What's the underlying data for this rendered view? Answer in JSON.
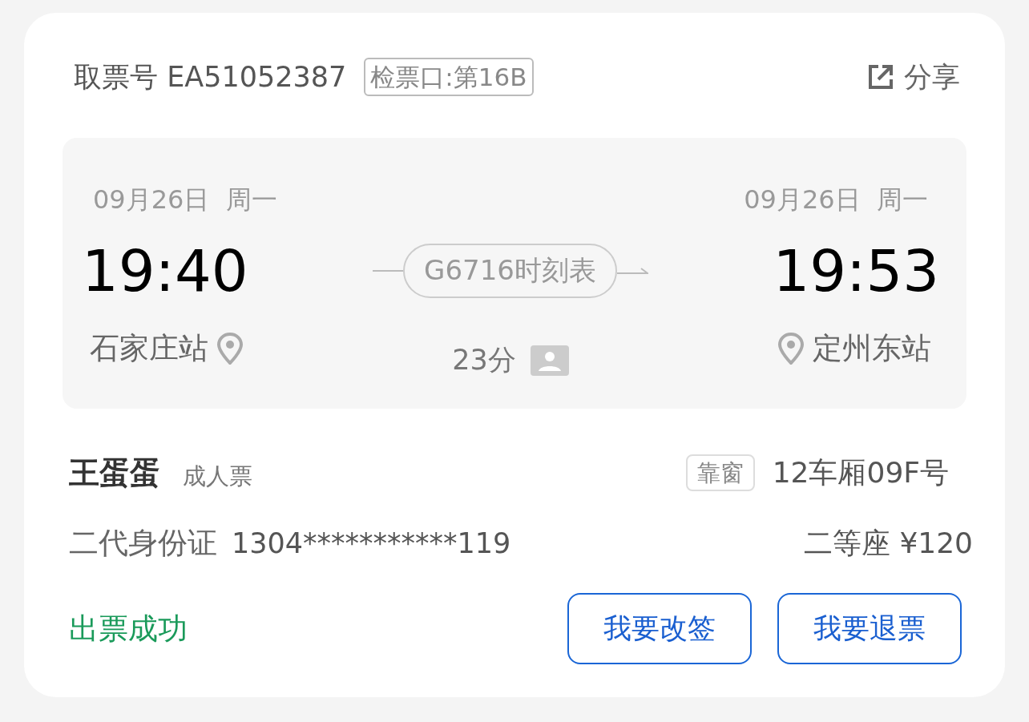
{
  "header": {
    "ticket_number": "取票号 EA51052387",
    "gate": "检票口:第16B",
    "share": "分享"
  },
  "journey": {
    "departure": {
      "date": "09月26日  周一",
      "time": "19:40",
      "station": "石家庄站"
    },
    "train": "G6716时刻表",
    "duration": "23分",
    "arrival": {
      "date": "09月26日  周一",
      "time": "19:53",
      "station": "定州东站"
    }
  },
  "passenger": {
    "name": "王蛋蛋",
    "ticket_type": "成人票",
    "seat_tag": "靠窗",
    "seat": "12车厢09F号",
    "id_type": "二代身份证",
    "id_number": "1304***********119",
    "seat_class_price": "二等座 ¥120"
  },
  "status": "出票成功",
  "buttons": [
    "我要改签",
    "我要退票"
  ]
}
